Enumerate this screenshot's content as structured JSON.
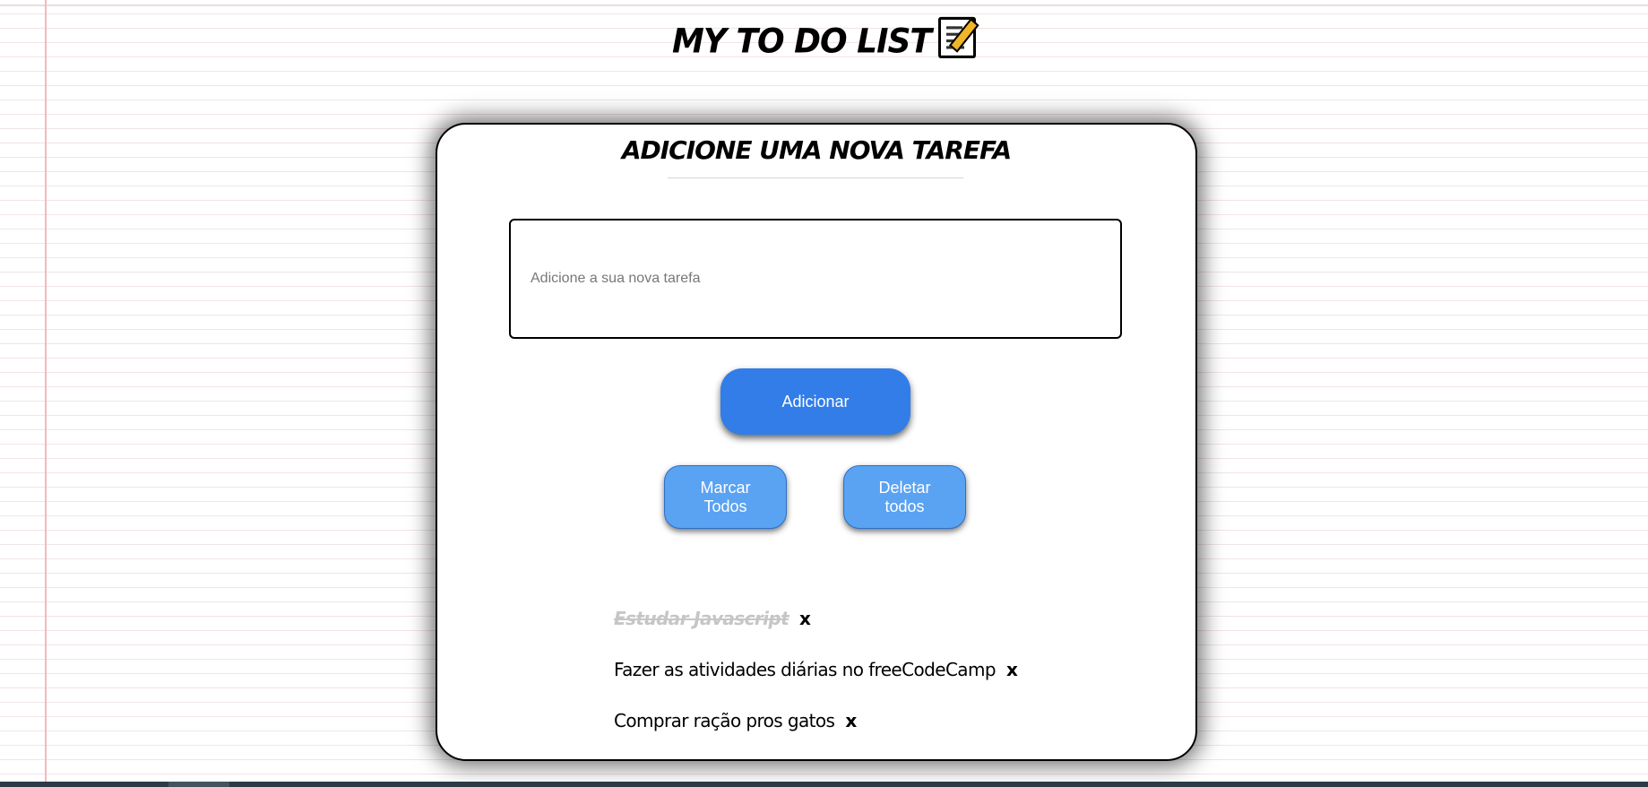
{
  "page": {
    "title": "MY TO DO LIST",
    "title_icon": "memo-notepad-icon"
  },
  "card": {
    "heading": "ADICIONE UMA NOVA TAREFA",
    "input": {
      "placeholder": "Adicione a sua nova tarefa",
      "value": ""
    },
    "add_button": "Adicionar",
    "mark_all_button": "Marcar Todos",
    "delete_all_button": "Deletar todos"
  },
  "tasks": [
    {
      "text": "Estudar Javascript",
      "done": true,
      "remove_label": "x"
    },
    {
      "text": "Fazer as atividades diárias no freeCodeCamp",
      "done": false,
      "remove_label": "x"
    },
    {
      "text": "Comprar ração pros gatos",
      "done": false,
      "remove_label": "x"
    }
  ],
  "colors": {
    "primary_button": "#327de8",
    "secondary_button": "#5aa2f2",
    "margin_line": "#f4b8bf",
    "done_text": "#c6c6c6"
  }
}
